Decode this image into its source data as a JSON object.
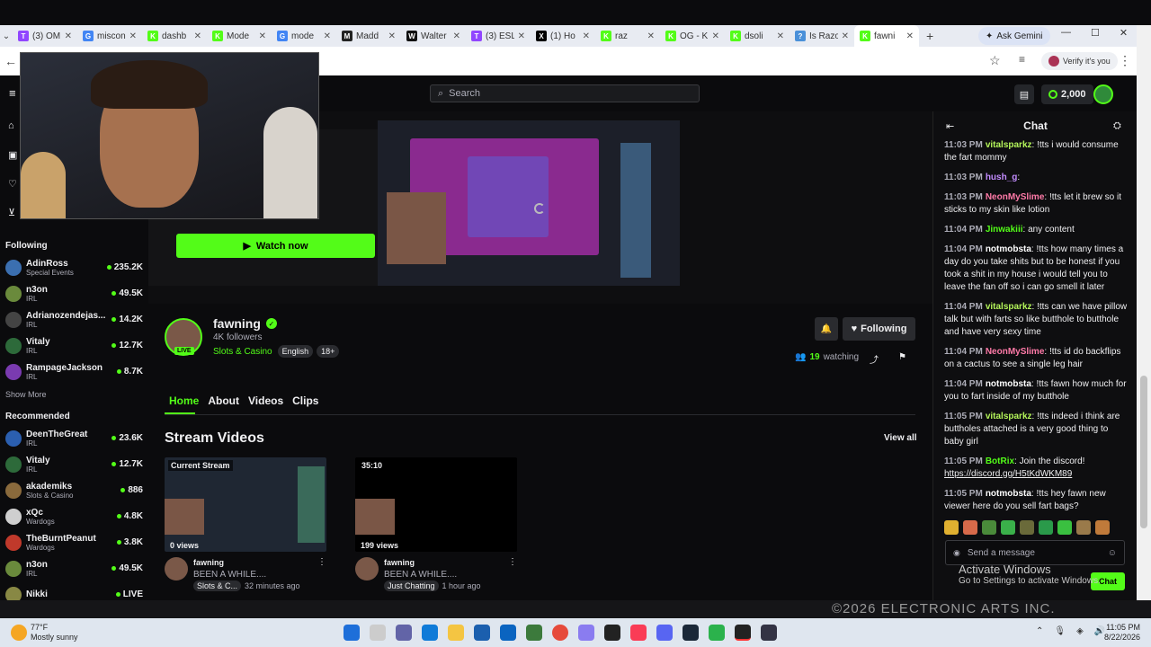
{
  "browser": {
    "tabs": [
      {
        "label": "(3) OM",
        "color": "#9146ff",
        "glyph": "T"
      },
      {
        "label": "miscon",
        "color": "#4285f4",
        "glyph": "G"
      },
      {
        "label": "dashb",
        "color": "#53fc18",
        "glyph": "K"
      },
      {
        "label": "Mode",
        "color": "#53fc18",
        "glyph": "K"
      },
      {
        "label": "mode",
        "color": "#4285f4",
        "glyph": "G"
      },
      {
        "label": "Madd",
        "color": "#222",
        "glyph": "M"
      },
      {
        "label": "Walter",
        "color": "#111",
        "glyph": "W"
      },
      {
        "label": "(3) ESL",
        "color": "#9146ff",
        "glyph": "T"
      },
      {
        "label": "(1) Ho",
        "color": "#000",
        "glyph": "X"
      },
      {
        "label": "raz",
        "color": "#53fc18",
        "glyph": "K"
      },
      {
        "label": "OG - K",
        "color": "#53fc18",
        "glyph": "K"
      },
      {
        "label": "dsoli",
        "color": "#53fc18",
        "glyph": "K"
      },
      {
        "label": "Is Razo",
        "color": "#4a90d9",
        "glyph": "?"
      },
      {
        "label": "fawni",
        "color": "#53fc18",
        "glyph": "K",
        "active": true
      }
    ],
    "ask_gemini": "Ask Gemini",
    "verify": "Verify it's you"
  },
  "kick": {
    "search_placeholder": "Search",
    "coins": "2,000",
    "watch_now": "Watch now",
    "streamer": {
      "name": "fawning",
      "followers": "4K followers",
      "category": "Slots & Casino",
      "tags": [
        "English",
        "18+"
      ],
      "live": "LIVE",
      "watching_count": "19",
      "watching_label": "watching",
      "following_label": "Following"
    },
    "nav_tabs": [
      "Home",
      "About",
      "Videos",
      "Clips"
    ],
    "stream_videos_title": "Stream Videos",
    "view_all": "View all",
    "videos": [
      {
        "badge": "Current Stream",
        "views": "0 views",
        "channel": "fawning",
        "title": "BEEN A WHILE....",
        "category": "Slots & C...",
        "time": "32 minutes ago"
      },
      {
        "badge": "35:10",
        "views": "199 views",
        "channel": "fawning",
        "title": "BEEN A WHILE....",
        "category": "Just Chatting",
        "time": "1 hour ago"
      }
    ],
    "sidebar": {
      "following_heading": "Following",
      "following": [
        {
          "name": "AdinRoss",
          "category": "Special Events",
          "viewers": "235.2K",
          "color": "#3b6fb0"
        },
        {
          "name": "n3on",
          "category": "IRL",
          "viewers": "49.5K",
          "color": "#6a8a3c"
        },
        {
          "name": "Adrianozendejas...",
          "category": "IRL",
          "viewers": "14.2K",
          "color": "#444"
        },
        {
          "name": "Vitaly",
          "category": "IRL",
          "viewers": "12.7K",
          "color": "#2d6a3a"
        },
        {
          "name": "RampageJackson",
          "category": "IRL",
          "viewers": "8.7K",
          "color": "#7a3bb0"
        }
      ],
      "show_more": "Show More",
      "recommended_heading": "Recommended",
      "recommended": [
        {
          "name": "DeenTheGreat",
          "category": "IRL",
          "viewers": "23.6K",
          "color": "#2b5fb0"
        },
        {
          "name": "Vitaly",
          "category": "IRL",
          "viewers": "12.7K",
          "color": "#2d6a3a"
        },
        {
          "name": "akademiks",
          "category": "Slots & Casino",
          "viewers": "886",
          "color": "#8a6a3c"
        },
        {
          "name": "xQc",
          "category": "Wardogs",
          "viewers": "4.8K",
          "color": "#cfcfcf"
        },
        {
          "name": "TheBurntPeanut",
          "category": "Wardogs",
          "viewers": "3.8K",
          "color": "#c0392b"
        },
        {
          "name": "n3on",
          "category": "IRL",
          "viewers": "49.5K",
          "color": "#6a8a3c"
        },
        {
          "name": "Nikki",
          "category": "",
          "viewers": "LIVE",
          "color": "#884"
        }
      ]
    },
    "chat": {
      "title": "Chat",
      "messages": [
        {
          "time": "11:03 PM",
          "user": "vitalsparkz",
          "color": "#b4f55a",
          "text": "!tts i would consume the fart mommy"
        },
        {
          "time": "11:03 PM",
          "user": "hush_g",
          "color": "#c38cff",
          "text": ""
        },
        {
          "time": "11:03 PM",
          "user": "NeonMySlime",
          "color": "#ff7aa8",
          "text": "!tts let it brew so it sticks to my skin like lotion"
        },
        {
          "time": "11:04 PM",
          "user": "Jinwakiii",
          "color": "#53fc18",
          "text": "any content"
        },
        {
          "time": "11:04 PM",
          "user": "notmobsta",
          "color": "#ffffff",
          "text": "!tts how many times a day do you take shits but to be honest if you took a shit in my house i would tell you to leave the fan off so i can go smell it later"
        },
        {
          "time": "11:04 PM",
          "user": "vitalsparkz",
          "color": "#b4f55a",
          "text": "!tts can we have pillow talk but with farts so like butthole to butthole and have very sexy time"
        },
        {
          "time": "11:04 PM",
          "user": "NeonMySlime",
          "color": "#ff7aa8",
          "text": "!tts id do backflips on a cactus to see a single leg hair"
        },
        {
          "time": "11:04 PM",
          "user": "notmobsta",
          "color": "#ffffff",
          "text": "!tts fawn how much for you to fart inside of my butthole"
        },
        {
          "time": "11:05 PM",
          "user": "vitalsparkz",
          "color": "#b4f55a",
          "text": "!tts indeed i think are buttholes attached is a very good thing to baby girl"
        },
        {
          "time": "11:05 PM",
          "user": "BotRix",
          "color": "#53fc18",
          "text": "Join the discord!",
          "link": "https://discord.gg/H5tKdWKM89"
        },
        {
          "time": "11:05 PM",
          "user": "notmobsta",
          "color": "#ffffff",
          "text": "!tts hey fawn new viewer here do you sell fart bags?"
        }
      ],
      "input_placeholder": "Send a message",
      "send_label": "Chat"
    }
  },
  "overlay": {
    "activate_title": "Activate Windows",
    "activate_sub": "Go to Settings to activate Windows.",
    "ea_footer": "©2026 ELECTRONIC ARTS INC."
  },
  "taskbar": {
    "weather_temp": "77°F",
    "weather_desc": "Mostly sunny",
    "time": "11:05 PM",
    "date": "8/22/2026"
  }
}
